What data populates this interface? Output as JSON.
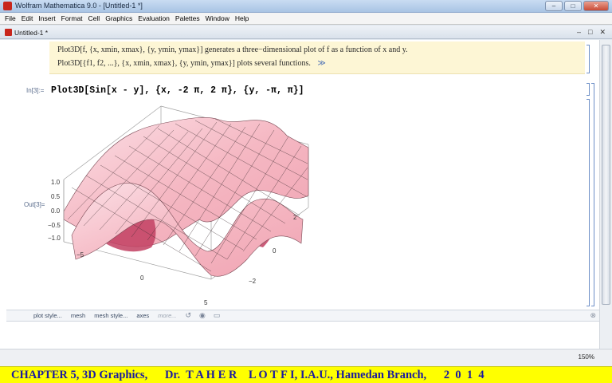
{
  "window": {
    "title": "Wolfram Mathematica 9.0 - [Untitled-1 *]",
    "buttons": {
      "minimize": "–",
      "maximize": "□",
      "close": "✕"
    }
  },
  "menu": [
    "File",
    "Edit",
    "Insert",
    "Format",
    "Cell",
    "Graphics",
    "Evaluation",
    "Palettes",
    "Window",
    "Help"
  ],
  "document": {
    "tab_title": "Untitled-1 *",
    "buttons": {
      "minimize": "–",
      "restore": "□",
      "close": "✕"
    }
  },
  "usage": {
    "line1": "Plot3D[f, {x, xmin, xmax}, {y, ymin, ymax}] generates a three−dimensional plot of f as a function of x and y.",
    "line2": "Plot3D[{f1, f2, ...}, {x, xmin, xmax}, {y, ymin, ymax}] plots several functions.",
    "more": "≫"
  },
  "cell": {
    "in_label": "In[3]:=",
    "input": "Plot3D[Sin[x - y], {x, -2 π, 2 π}, {y, -π, π}]",
    "out_label": "Out[3]="
  },
  "plot": {
    "z_ticks": [
      "1.0",
      "0.5",
      "0.0",
      "−0.5",
      "−1.0"
    ],
    "x_ticks": [
      "−5",
      "0",
      "5"
    ],
    "y_ticks": [
      "2",
      "0",
      "−2"
    ],
    "surface_color": "#f7c0c8",
    "shadow_color": "#c23f62"
  },
  "suggestions": {
    "items": [
      "plot style...",
      "mesh",
      "mesh style...",
      "axes",
      "more..."
    ],
    "close": "⊗"
  },
  "status": {
    "zoom": "150%"
  },
  "banner": {
    "text": "CHAPTER 5, 3D Graphics,      Dr.  T A H E R    L O T F I, I.A.U., Hamedan Branch,      2  0  1  4"
  }
}
